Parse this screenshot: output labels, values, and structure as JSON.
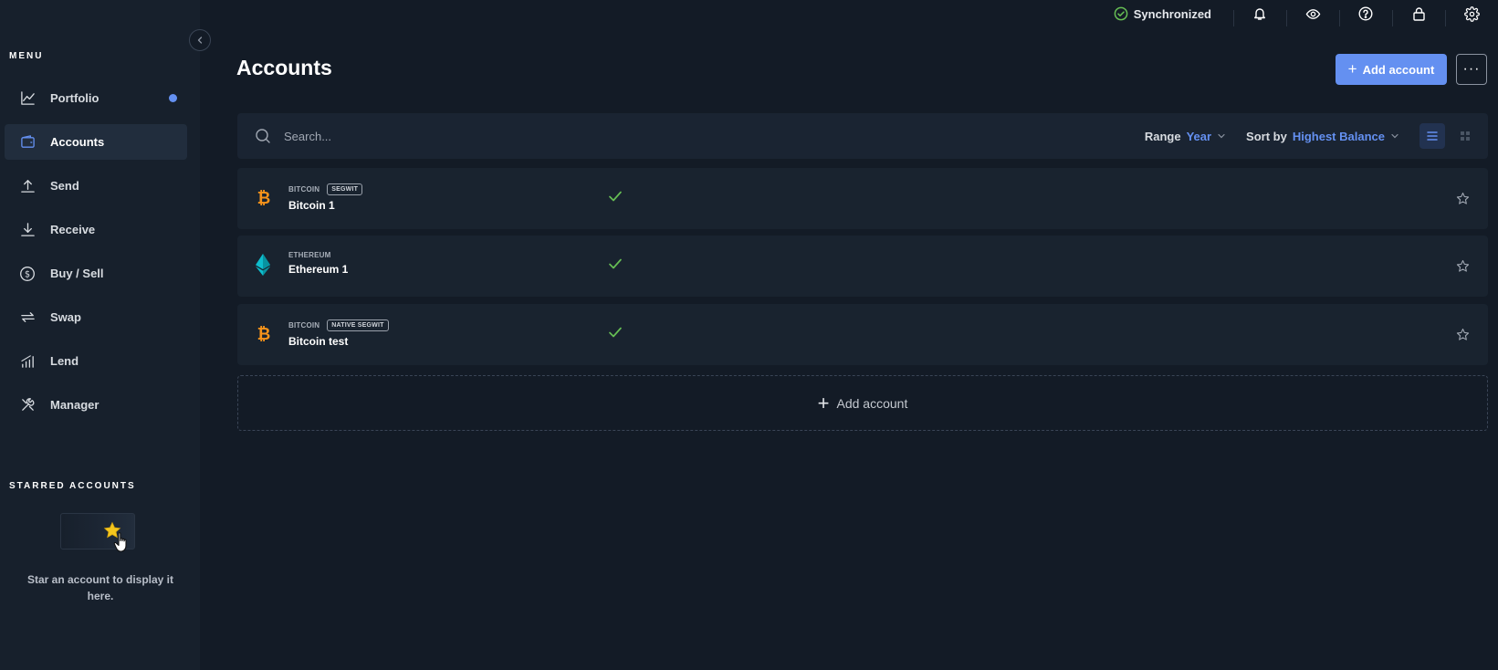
{
  "colors": {
    "accent": "#6490f1",
    "background": "#131b26",
    "sidebar": "#17202c",
    "success": "#66be54",
    "bitcoin": "#f7931a",
    "ethereum": "#0ebdcd"
  },
  "topbar": {
    "sync_label": "Synchronized",
    "icons": [
      "bell-icon",
      "eye-icon",
      "help-icon",
      "lock-icon",
      "settings-icon"
    ]
  },
  "sidebar": {
    "menu_title": "MENU",
    "items": [
      {
        "label": "Portfolio",
        "icon": "chart-icon",
        "active": false,
        "badge": true
      },
      {
        "label": "Accounts",
        "icon": "wallet-icon",
        "active": true
      },
      {
        "label": "Send",
        "icon": "send-icon"
      },
      {
        "label": "Receive",
        "icon": "receive-icon"
      },
      {
        "label": "Buy / Sell",
        "icon": "dollar-icon"
      },
      {
        "label": "Swap",
        "icon": "swap-icon"
      },
      {
        "label": "Lend",
        "icon": "lend-icon"
      },
      {
        "label": "Manager",
        "icon": "tools-icon"
      }
    ],
    "starred_title": "STARRED ACCOUNTS",
    "starred_empty": "Star an account to display it here."
  },
  "main": {
    "title": "Accounts",
    "add_account_label": "Add account",
    "more_label": "···",
    "search": {
      "placeholder": "Search..."
    },
    "range": {
      "label": "Range",
      "value": "Year"
    },
    "sort": {
      "label": "Sort by",
      "value": "Highest Balance"
    },
    "accounts": [
      {
        "currency": "BITCOIN",
        "tag": "SEGWIT",
        "name": "Bitcoin 1",
        "coin": "bitcoin"
      },
      {
        "currency": "ETHEREUM",
        "tag": "",
        "name": "Ethereum 1",
        "coin": "ethereum"
      },
      {
        "currency": "BITCOIN",
        "tag": "NATIVE SEGWIT",
        "name": "Bitcoin test",
        "coin": "bitcoin"
      }
    ],
    "add_account_row_label": "Add account"
  }
}
